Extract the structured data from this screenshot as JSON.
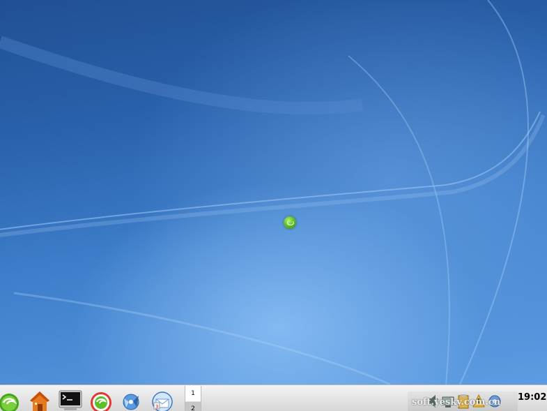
{
  "desktop": {
    "center_logo": "opensuse-logo-icon"
  },
  "taskbar": {
    "launchers": [
      {
        "name": "kmenu-button",
        "icon": "opensuse-menu-icon"
      },
      {
        "name": "home-folder-launcher",
        "icon": "home-icon"
      },
      {
        "name": "terminal-launcher",
        "icon": "terminal-icon"
      },
      {
        "name": "yast-launcher",
        "icon": "opensuse-yast-icon"
      },
      {
        "name": "konqueror-launcher",
        "icon": "konqueror-icon"
      },
      {
        "name": "kontact-launcher",
        "icon": "kontact-icon"
      }
    ],
    "pager": {
      "desktops": [
        "1",
        "2"
      ],
      "active": "1"
    },
    "tray": {
      "icons": [
        "speaker-icon",
        "network-icon",
        "clipboard-icon",
        "update-icon",
        "settings-icon"
      ]
    },
    "clock": "19:02",
    "watermark": "soft.yesky.com.cn"
  }
}
